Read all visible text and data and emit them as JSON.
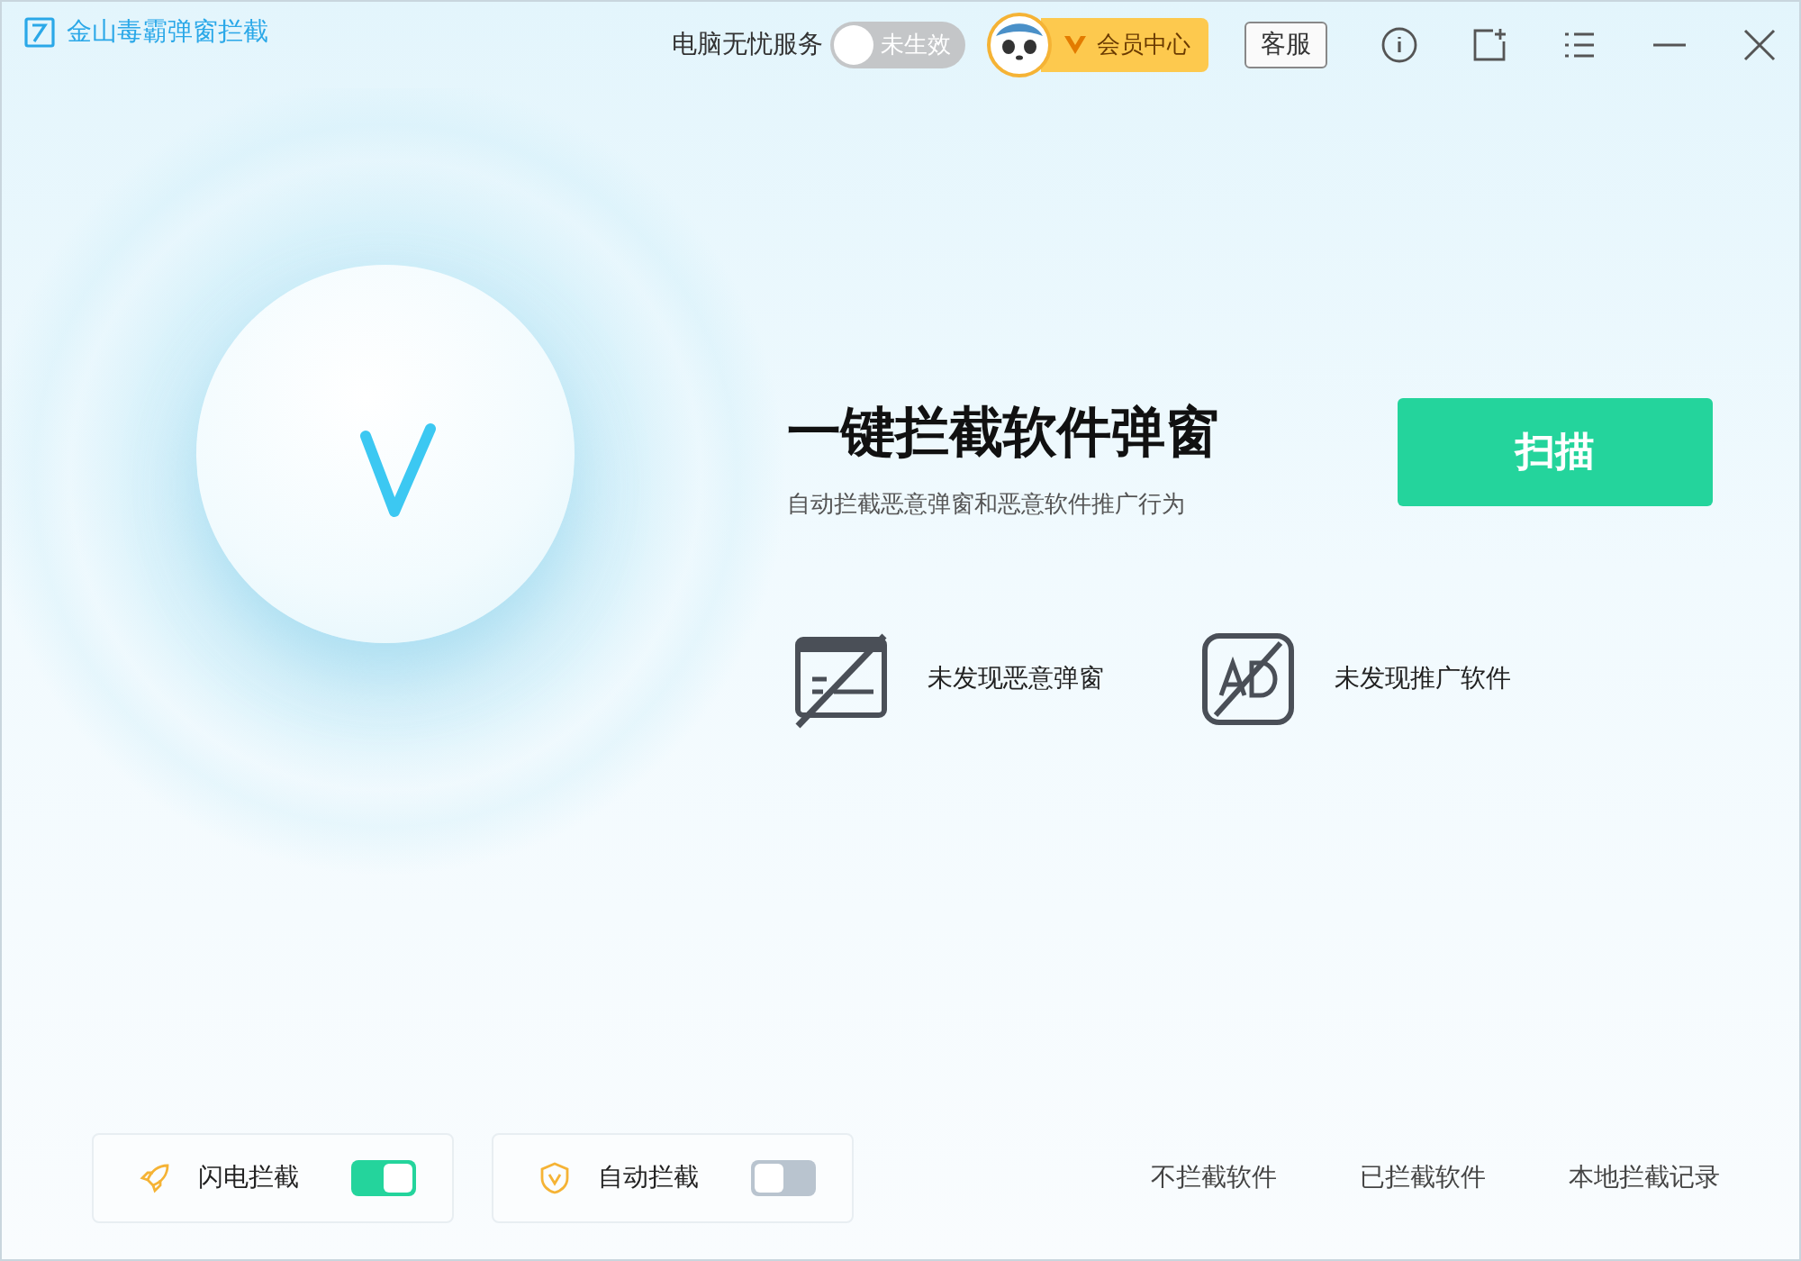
{
  "window": {
    "title": "金山毒霸弹窗拦截"
  },
  "service": {
    "label": "电脑无忧服务",
    "toggle": {
      "on": false,
      "text": "未生效"
    }
  },
  "vip": {
    "label": "会员中心"
  },
  "support_button": "客服",
  "hero": {
    "title": "一键拦截软件弹窗",
    "subtitle": "自动拦截恶意弹窗和恶意软件推广行为",
    "scan_button": "扫描"
  },
  "status_items": [
    {
      "kind": "popup",
      "text": "未发现恶意弹窗"
    },
    {
      "kind": "ad",
      "text": "未发现推广软件"
    }
  ],
  "toggles": [
    {
      "kind": "flash",
      "label": "闪电拦截",
      "on": true
    },
    {
      "kind": "shield",
      "label": "自动拦截",
      "on": false
    }
  ],
  "links": [
    "不拦截软件",
    "已拦截软件",
    "本地拦截记录"
  ]
}
